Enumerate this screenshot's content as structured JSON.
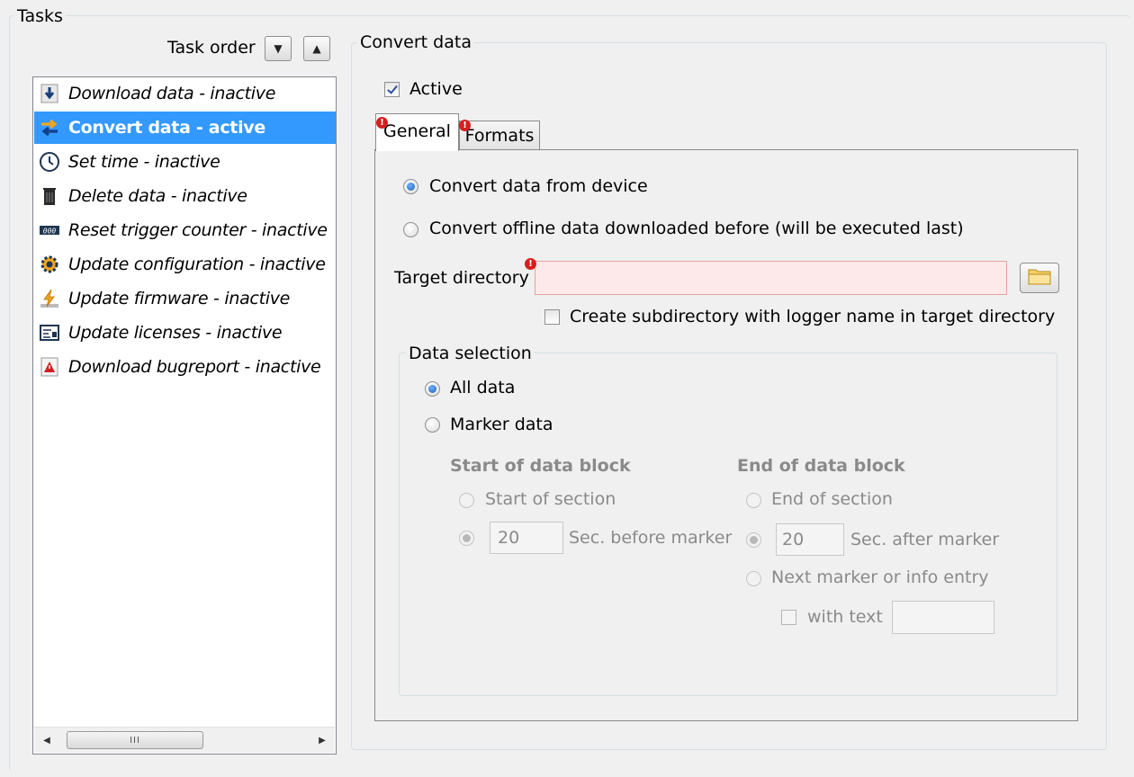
{
  "tasks_group": {
    "legend": "Tasks"
  },
  "task_order": {
    "label": "Task order",
    "down_glyph": "▼",
    "up_glyph": "▲"
  },
  "task_list": [
    {
      "label": "Download data - inactive",
      "icon": "download-icon",
      "selected": false
    },
    {
      "label": "Convert data - active",
      "icon": "convert-icon",
      "selected": true
    },
    {
      "label": "Set time - inactive",
      "icon": "clock-icon",
      "selected": false
    },
    {
      "label": "Delete data - inactive",
      "icon": "trash-icon",
      "selected": false
    },
    {
      "label": "Reset trigger counter - inactive",
      "icon": "counter-icon",
      "selected": false
    },
    {
      "label": "Update configuration - inactive",
      "icon": "gear-icon",
      "selected": false
    },
    {
      "label": "Update firmware - inactive",
      "icon": "firmware-icon",
      "selected": false
    },
    {
      "label": "Update licenses - inactive",
      "icon": "license-icon",
      "selected": false
    },
    {
      "label": "Download bugreport - inactive",
      "icon": "bugreport-icon",
      "selected": false
    }
  ],
  "scrollbar": {
    "left_glyph": "◀",
    "right_glyph": "▶",
    "thumb_grip": "III"
  },
  "convert": {
    "legend": "Convert data",
    "active_label": "Active",
    "active_checked": true,
    "tabs": [
      {
        "label": "General",
        "active": true,
        "error": true
      },
      {
        "label": "Formats",
        "active": false,
        "error": true
      }
    ],
    "source": {
      "from_device_label": "Convert data from device",
      "offline_label": "Convert offline data downloaded before (will be executed last)",
      "selected": "from_device"
    },
    "target_directory": {
      "label": "Target directory",
      "value": "",
      "error": true,
      "browse_icon": "folder-icon"
    },
    "subdirectory": {
      "label": "Create subdirectory with logger name in target directory",
      "checked": false
    },
    "data_selection": {
      "legend": "Data selection",
      "all_label": "All data",
      "marker_label": "Marker data",
      "selected": "all",
      "start_block": {
        "heading": "Start of data block",
        "start_of_section_label": "Start of section",
        "seconds_value": "20",
        "seconds_label": "Sec. before marker"
      },
      "end_block": {
        "heading": "End of data block",
        "end_of_section_label": "End of section",
        "seconds_value": "20",
        "seconds_label": "Sec. after marker",
        "next_marker_label": "Next marker or info entry",
        "with_text_label": "with text",
        "with_text_value": ""
      }
    }
  },
  "colors": {
    "selection": "#3399ff",
    "error_field": "#fde9e9",
    "error_mark": "#d42020",
    "disabled_text": "#8a8a8a"
  }
}
